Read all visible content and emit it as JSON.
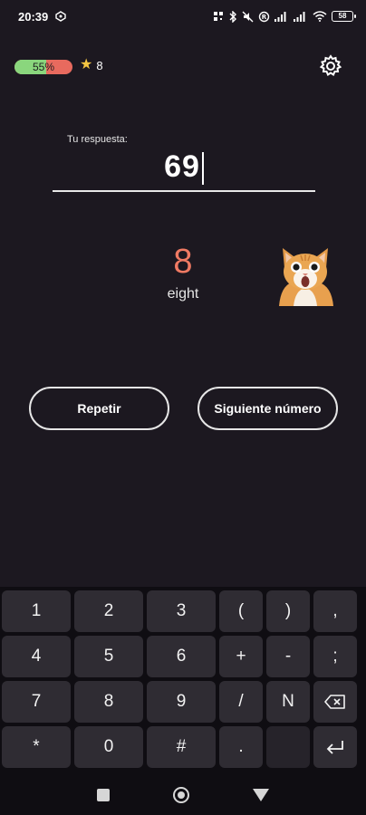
{
  "status_bar": {
    "time": "20:39",
    "battery": "58"
  },
  "header": {
    "progress_text": "55%",
    "progress_value": 0.55,
    "stars_count": "8"
  },
  "answer": {
    "label": "Tu respuesta:",
    "value": "69"
  },
  "number": {
    "digit": "8",
    "word": "eight"
  },
  "buttons": {
    "repeat": "Repetir",
    "next": "Siguiente número"
  },
  "keyboard": {
    "rows": [
      [
        "1",
        "2",
        "3",
        "(",
        ")",
        ","
      ],
      [
        "4",
        "5",
        "6",
        "+",
        "-",
        ";"
      ],
      [
        "7",
        "8",
        "9",
        "/",
        "N",
        "backspace"
      ],
      [
        "*",
        "0",
        "#",
        ".",
        "",
        "enter"
      ]
    ]
  },
  "colors": {
    "background": "#1c1820",
    "number_accent": "#f07a63",
    "progress_good": "#8ad67d",
    "progress_bad": "#e86a5e",
    "star": "#f4c542"
  },
  "icons": {
    "settings": "gear-icon",
    "star": "star-icon",
    "backspace": "backspace-icon",
    "enter": "enter-icon"
  }
}
